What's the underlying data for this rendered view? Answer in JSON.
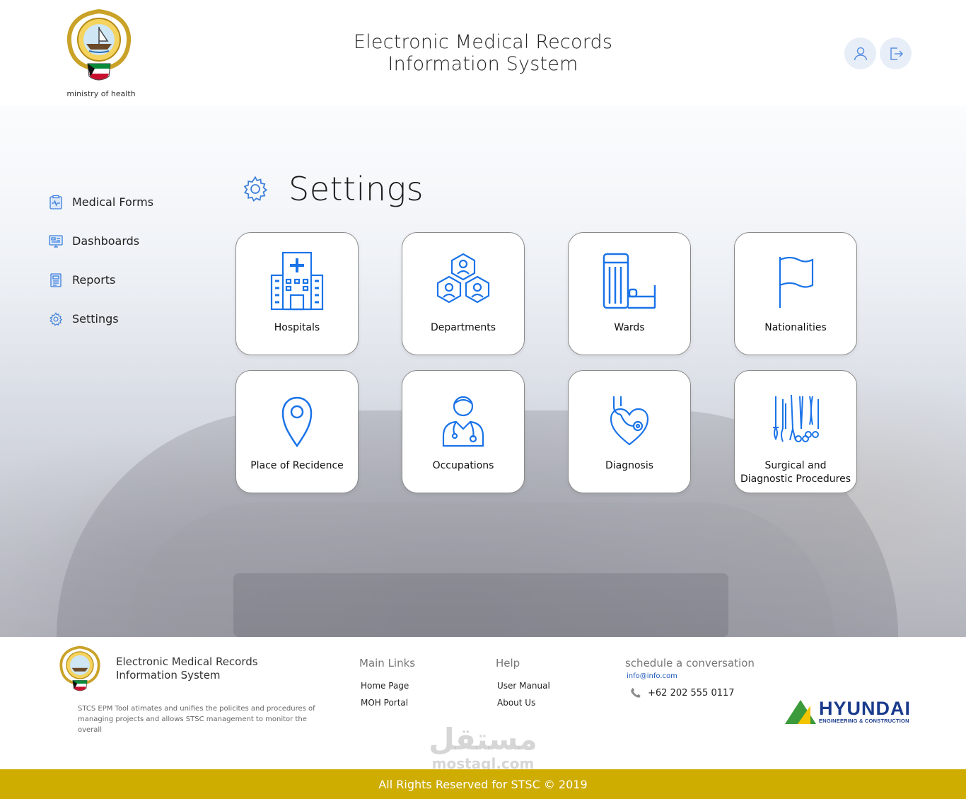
{
  "header": {
    "logo_caption": "ministry of health",
    "title_line1": "Electronic Medical Records",
    "title_line2": "Information System",
    "profile_icon": "user-icon",
    "logout_icon": "logout-icon"
  },
  "sidebar": {
    "items": [
      {
        "label": "Medical Forms",
        "icon": "medical-form-icon"
      },
      {
        "label": "Dashboards",
        "icon": "dashboard-icon"
      },
      {
        "label": "Reports",
        "icon": "report-icon"
      },
      {
        "label": "Settings",
        "icon": "gear-icon"
      }
    ]
  },
  "main": {
    "title": "Settings",
    "cards": [
      {
        "label": "Hospitals",
        "icon": "hospital-icon"
      },
      {
        "label": "Departments",
        "icon": "departments-icon"
      },
      {
        "label": "Wards",
        "icon": "bed-icon"
      },
      {
        "label": "Nationalities",
        "icon": "flag-icon"
      },
      {
        "label": "Place of Recidence",
        "icon": "location-pin-icon"
      },
      {
        "label": "Occupations",
        "icon": "doctor-icon"
      },
      {
        "label": "Diagnosis",
        "icon": "stethoscope-heart-icon"
      },
      {
        "label": "Surgical and Diagnostic Procedures",
        "icon": "surgical-tools-icon"
      }
    ]
  },
  "footer": {
    "title_line1": "Electronic Medical Records",
    "title_line2": "Information System",
    "description": "STCS EPM Tool atimates and unifies the policites and procedures of managing projects and allows STSC management to monitor the overall",
    "main_links_heading": "Main Links",
    "main_links": [
      "Home Page",
      "MOH Portal"
    ],
    "help_heading": "Help",
    "help_links": [
      "User Manual",
      "About Us"
    ],
    "schedule_heading": "schedule a conversation",
    "email": "info@info.com",
    "phone": "+62 202 555 0117",
    "partner_name": "HYUNDAI",
    "partner_sub": "ENGINEERING & CONSTRUCTION",
    "copyright": "All Rights Reserved for STSC © 2019"
  },
  "watermark": {
    "arabic": "مستقل",
    "latin": "mostaql.com"
  },
  "colors": {
    "accent_blue": "#1a73e8",
    "gold_bar": "#ceac00",
    "partner_blue": "#1a3b8c"
  }
}
